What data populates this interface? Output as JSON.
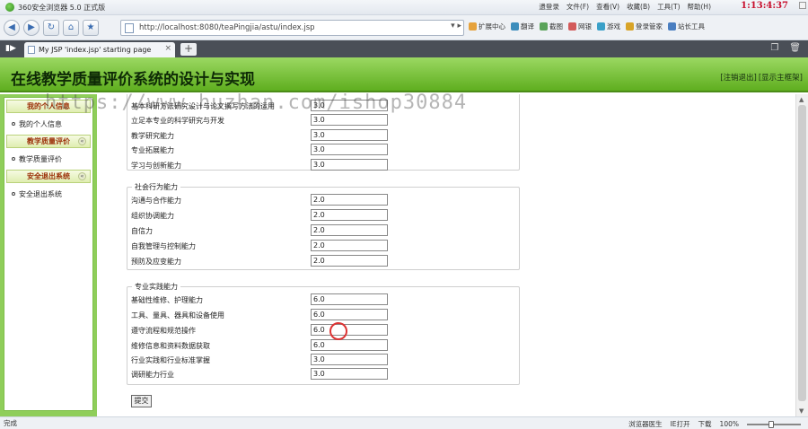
{
  "browser": {
    "title": "360安全浏览器 5.0 正式版",
    "menu": [
      "遗登录",
      "文件(F)",
      "查看(V)",
      "收藏(B)",
      "工具(T)",
      "帮助(H)"
    ],
    "clock": "1:13:4:37",
    "address": "http://localhost:8080/teaPingjia/astu/index.jsp",
    "toolbar": [
      "扩展中心",
      "翻译",
      "截图",
      "网银",
      "游戏",
      "登录管家",
      "站长工具"
    ],
    "tab_title": "My JSP 'index.jsp' starting page",
    "status_left": "完成",
    "status_right": [
      "浏览器医生",
      "IE打开",
      "下载"
    ],
    "zoom": "100%"
  },
  "page": {
    "site_title": "在线教学质量评价系统的设计与实现",
    "header_links": [
      "[注销退出]",
      "[显示主框架]"
    ]
  },
  "sidebar": {
    "sections": [
      {
        "title": "我的个人信息",
        "items": [
          "我的个人信息"
        ]
      },
      {
        "title": "教学质量评价",
        "items": [
          "教学质量评价"
        ]
      },
      {
        "title": "安全退出系统",
        "items": [
          "安全退出系统"
        ]
      }
    ]
  },
  "watermark": "https://www.huzhan.com/ishop30884",
  "groups": [
    {
      "legend": "",
      "rows": [
        {
          "label": "基本科研方法研究设计与论文撰写方法的运用",
          "value": "3.0"
        },
        {
          "label": "立足本专业的科学研究与开发",
          "value": "3.0"
        },
        {
          "label": "教学研究能力",
          "value": "3.0"
        },
        {
          "label": "专业拓展能力",
          "value": "3.0"
        },
        {
          "label": "学习与创新能力",
          "value": "3.0"
        }
      ]
    },
    {
      "legend": "社会行为能力",
      "rows": [
        {
          "label": "沟通与合作能力",
          "value": "2.0"
        },
        {
          "label": "组织协调能力",
          "value": "2.0"
        },
        {
          "label": "自信力",
          "value": "2.0"
        },
        {
          "label": "自我管理与控制能力",
          "value": "2.0"
        },
        {
          "label": "预防及应变能力",
          "value": "2.0"
        }
      ]
    },
    {
      "legend": "专业实践能力",
      "rows": [
        {
          "label": "基础性维修、护理能力",
          "value": "6.0"
        },
        {
          "label": "工具、量具、器具和设备使用",
          "value": "6.0"
        },
        {
          "label": "遵守流程和规范操作",
          "value": "6.0"
        },
        {
          "label": "维修信息和资料数据获取",
          "value": "6.0"
        },
        {
          "label": "行业实践和行业标准掌握",
          "value": "3.0"
        },
        {
          "label": "调研能力行业",
          "value": "3.0"
        }
      ]
    }
  ],
  "submit_label": "提交"
}
